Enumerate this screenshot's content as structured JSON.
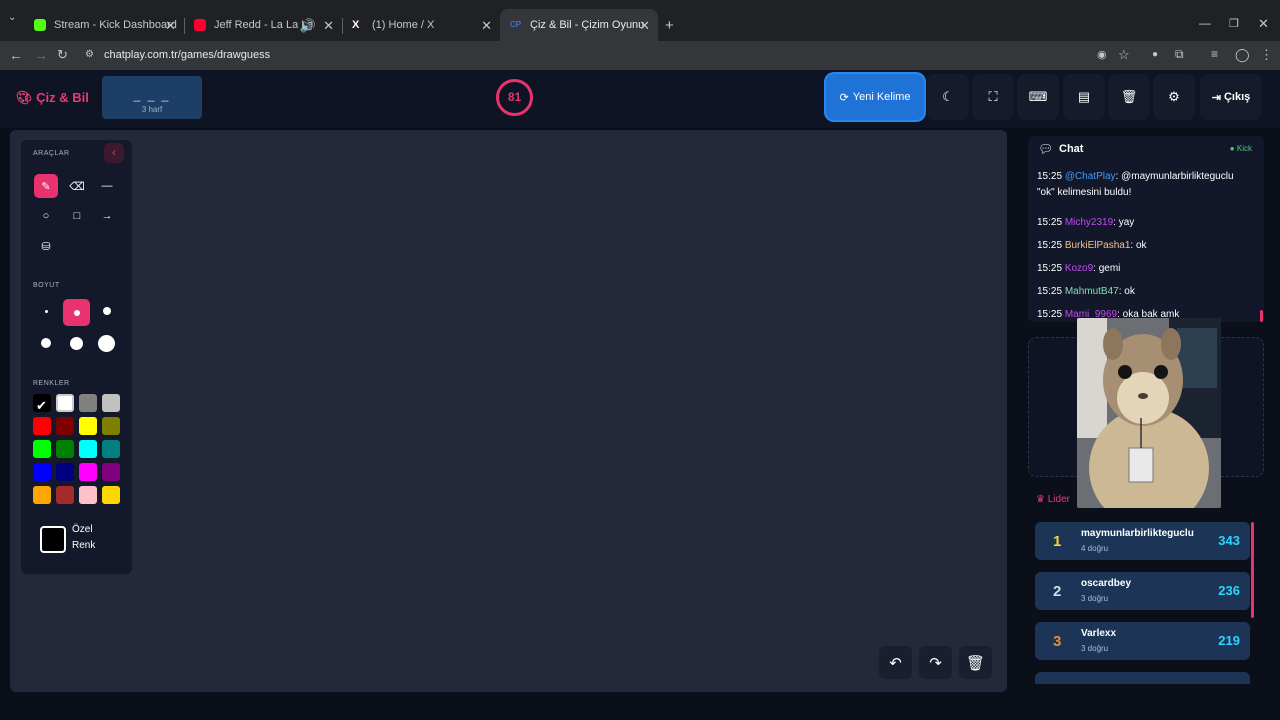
{
  "browser": {
    "tabs": [
      {
        "title": "Stream - Kick Dashboard",
        "color": "#53fc18"
      },
      {
        "title": "Jeff Redd - La La La ! [Offici",
        "color": "#ff0033"
      },
      {
        "title": "(1) Home / X",
        "color": "#ffffff"
      },
      {
        "title": "Çiz & Bil - Çizim Oyunu",
        "color": "#3d8cff"
      }
    ],
    "url": "chatplay.com.tr/games/drawguess"
  },
  "header": {
    "brand": "Çiz & Bil",
    "word_hint": "_ _ _",
    "letters": "3 harf",
    "timer": "81",
    "new_word": "Yeni Kelime",
    "exit": "Çıkış"
  },
  "tools": {
    "section_tools": "ARAÇLAR",
    "section_size": "BOYUT",
    "section_colors": "RENKLER",
    "custom_color_1": "Özel",
    "custom_color_2": "Renk",
    "colors": [
      "#000000",
      "#ffffff",
      "#808080",
      "#c0c0c0",
      "#ff0000",
      "#800000",
      "#ffff00",
      "#808000",
      "#00ff00",
      "#008000",
      "#00ffff",
      "#008080",
      "#0000ff",
      "#000080",
      "#ff00ff",
      "#800080",
      "#ffa500",
      "#a52a2a",
      "#ffc0cb",
      "#ffd700"
    ]
  },
  "chat": {
    "title": "Chat",
    "source": "Kick",
    "messages": [
      {
        "time": "15:25",
        "user": "@ChatPlay",
        "user_color": "#3d9cff",
        "text": ": @maymunlarbirlikteguclu \"ok\" kelimesini buldu!"
      },
      {
        "time": "15:25",
        "user": "Michy2319",
        "user_color": "#c04cf0",
        "text": ": yay"
      },
      {
        "time": "15:25",
        "user": "BurkiElPasha1",
        "user_color": "#f5c08a",
        "text": ": ok"
      },
      {
        "time": "15:25",
        "user": "Kozo9",
        "user_color": "#c04cf0",
        "text": ": gemi"
      },
      {
        "time": "15:25",
        "user": "MahmutB47",
        "user_color": "#7fe0b0",
        "text": ": ok"
      },
      {
        "time": "15:25",
        "user": "Mami_9969",
        "user_color": "#c04cf0",
        "text": ": oka bak amk"
      }
    ]
  },
  "leaderboard": {
    "title": "Lider",
    "rows": [
      {
        "rank": "1",
        "name": "maymunlarbirlikteguclu",
        "correct": "4 doğru",
        "score": "343",
        "rank_color": "#ffd23f"
      },
      {
        "rank": "2",
        "name": "oscardbey",
        "correct": "3 doğru",
        "score": "236",
        "rank_color": "#d7dbe3"
      },
      {
        "rank": "3",
        "name": "Varlexx",
        "correct": "3 doğru",
        "score": "219",
        "rank_color": "#e0903a"
      }
    ]
  }
}
